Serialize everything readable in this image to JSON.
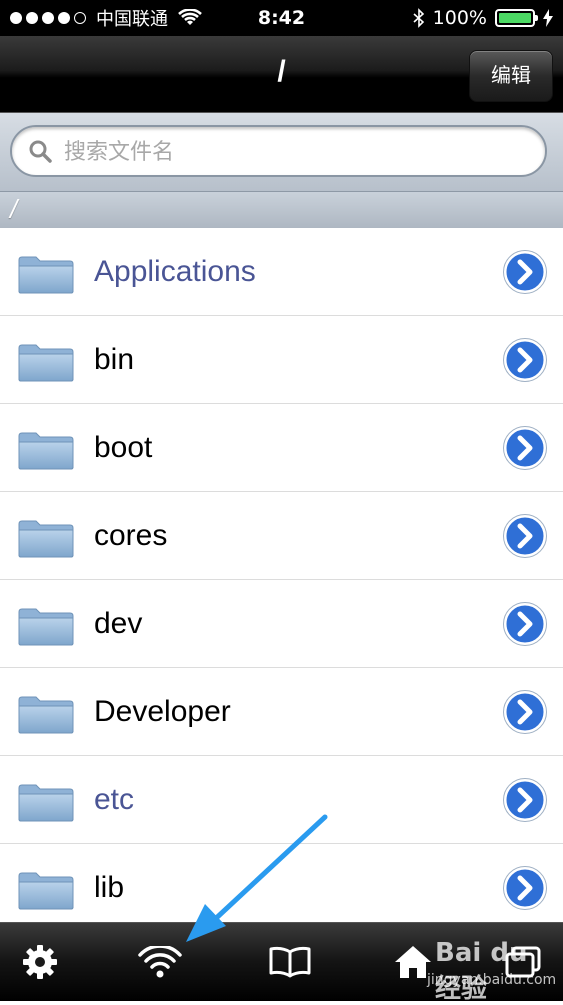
{
  "status_bar": {
    "carrier": "中国联通",
    "time": "8:42",
    "battery_percent": "100%",
    "battery_level": 1.0,
    "signal_bars_filled": 4,
    "signal_bars_total": 5
  },
  "nav": {
    "title": "/",
    "edit_label": "编辑"
  },
  "search": {
    "placeholder": "搜索文件名",
    "value": ""
  },
  "path": {
    "current": "/"
  },
  "files": [
    {
      "name": "Applications",
      "highlight": true
    },
    {
      "name": "bin",
      "highlight": false
    },
    {
      "name": "boot",
      "highlight": false
    },
    {
      "name": "cores",
      "highlight": false
    },
    {
      "name": "dev",
      "highlight": false
    },
    {
      "name": "Developer",
      "highlight": false
    },
    {
      "name": "etc",
      "highlight": true
    },
    {
      "name": "lib",
      "highlight": false
    }
  ],
  "tabbar": {
    "tabs": [
      {
        "icon": "gear-icon"
      },
      {
        "icon": "wifi-icon"
      },
      {
        "icon": "book-icon"
      },
      {
        "icon": "home-icon"
      },
      {
        "icon": "windows-icon"
      }
    ]
  },
  "watermark": {
    "brand": "Bai du 经验",
    "url": "jingyan.baidu.com"
  },
  "colors": {
    "folder_label_highlight": "#4a5595",
    "disclosure_blue": "#2f6fd6",
    "battery_green": "#4cd964",
    "annotation_arrow": "#2a9bef"
  }
}
